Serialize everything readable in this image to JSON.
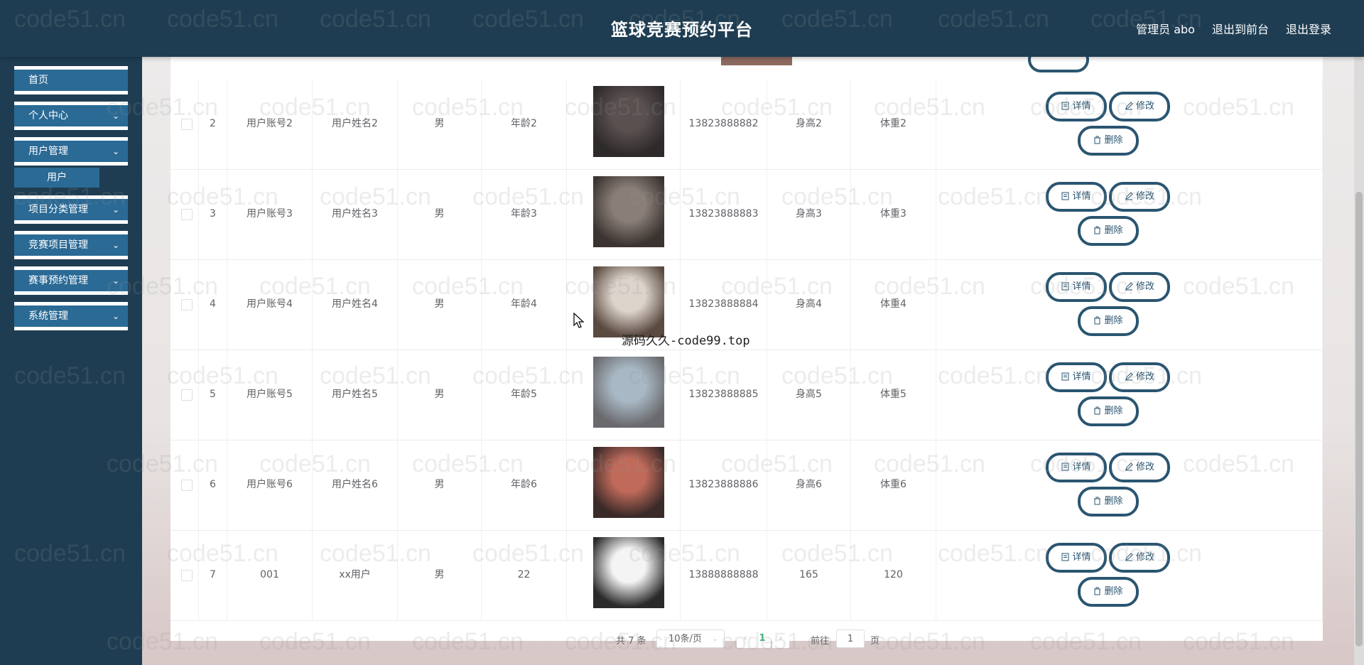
{
  "header": {
    "title": "篮球竞赛预约平台",
    "admin": "管理员 abo",
    "to_front": "退出到前台",
    "logout": "退出登录"
  },
  "sidebar": {
    "items": [
      {
        "label": "首页",
        "chevron": false
      },
      {
        "label": "个人中心",
        "chevron": true
      },
      {
        "label": "用户管理",
        "chevron": true
      },
      {
        "label": "项目分类管理",
        "chevron": true
      },
      {
        "label": "竞赛项目管理",
        "chevron": true
      },
      {
        "label": "赛事预约管理",
        "chevron": true
      },
      {
        "label": "系统管理",
        "chevron": true
      }
    ],
    "sub_item": "用户"
  },
  "table": {
    "rows": [
      {
        "index": "2",
        "account": "用户账号2",
        "name": "用户姓名2",
        "gender": "男",
        "age": "年龄2",
        "phone": "13823888882",
        "height": "身高2",
        "weight": "体重2"
      },
      {
        "index": "3",
        "account": "用户账号3",
        "name": "用户姓名3",
        "gender": "男",
        "age": "年龄3",
        "phone": "13823888883",
        "height": "身高3",
        "weight": "体重3"
      },
      {
        "index": "4",
        "account": "用户账号4",
        "name": "用户姓名4",
        "gender": "男",
        "age": "年龄4",
        "phone": "13823888884",
        "height": "身高4",
        "weight": "体重4"
      },
      {
        "index": "5",
        "account": "用户账号5",
        "name": "用户姓名5",
        "gender": "男",
        "age": "年龄5",
        "phone": "13823888885",
        "height": "身高5",
        "weight": "体重5"
      },
      {
        "index": "6",
        "account": "用户账号6",
        "name": "用户姓名6",
        "gender": "男",
        "age": "年龄6",
        "phone": "13823888886",
        "height": "身高6",
        "weight": "体重6"
      },
      {
        "index": "7",
        "account": "001",
        "name": "xx用户",
        "gender": "男",
        "age": "22",
        "phone": "13888888888",
        "height": "165",
        "weight": "120"
      }
    ],
    "actions": {
      "detail": "详情",
      "edit": "修改",
      "delete": "删除"
    }
  },
  "pagination": {
    "total": "共 7 条",
    "page_size": "10条/页",
    "current_page": "1",
    "goto_label": "前往",
    "goto_value": "1",
    "page_suffix": "页"
  },
  "overlay_text": "源码久久-code99.top",
  "watermark": "code51.cn",
  "colors": {
    "header_bg": "#1e3d52",
    "menu_item_bg": "#2a6a95",
    "button_border": "#2a5570",
    "active_page": "#3db27a"
  }
}
